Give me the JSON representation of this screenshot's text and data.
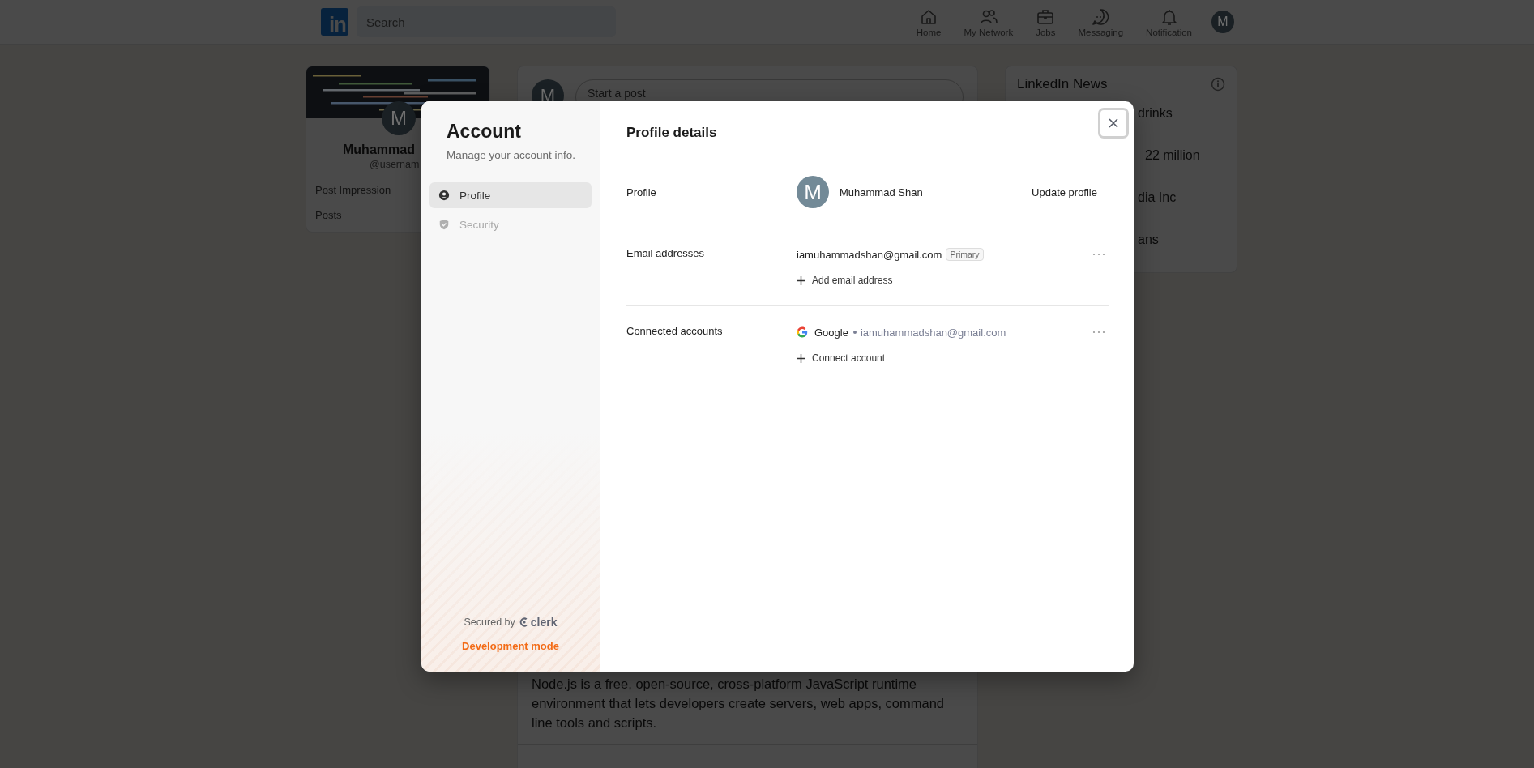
{
  "nav": {
    "logo": "in",
    "search_placeholder": "Search",
    "items": [
      {
        "label": "Home"
      },
      {
        "label": "My Network"
      },
      {
        "label": "Jobs"
      },
      {
        "label": "Messaging"
      },
      {
        "label": "Notification"
      }
    ],
    "avatar": "M"
  },
  "profile_card": {
    "avatar": "M",
    "name": "Muhammad",
    "username": "@usernam",
    "stats": [
      "Post Impression",
      "Posts"
    ]
  },
  "composer": {
    "avatar": "M",
    "placeholder": "Start a post"
  },
  "post": {
    "text": "Node.js is a free, open-source, cross-platform JavaScript runtime environment that lets developers create servers, web apps, command line tools and scripts."
  },
  "news": {
    "title": "LinkedIn News",
    "items": [
      "drinks",
      "22 million",
      "dia Inc",
      "ans"
    ]
  },
  "account": {
    "title": "Account",
    "subtitle": "Manage your account info.",
    "nav": [
      {
        "label": "Profile",
        "selected": true
      },
      {
        "label": "Security",
        "selected": false
      }
    ],
    "secured_by": "Secured by",
    "brand": "clerk",
    "mode": "Development mode"
  },
  "profile_details": {
    "title": "Profile details",
    "profile": {
      "label": "Profile",
      "avatar": "M",
      "name": "Muhammad Shan",
      "action": "Update profile"
    },
    "emails": {
      "label": "Email addresses",
      "items": [
        {
          "address": "iamuhammadshan@gmail.com",
          "badge": "Primary"
        }
      ],
      "add": "Add email address"
    },
    "connected": {
      "label": "Connected accounts",
      "items": [
        {
          "provider": "Google",
          "email": "iamuhammadshan@gmail.com"
        }
      ],
      "add": "Connect account"
    }
  }
}
